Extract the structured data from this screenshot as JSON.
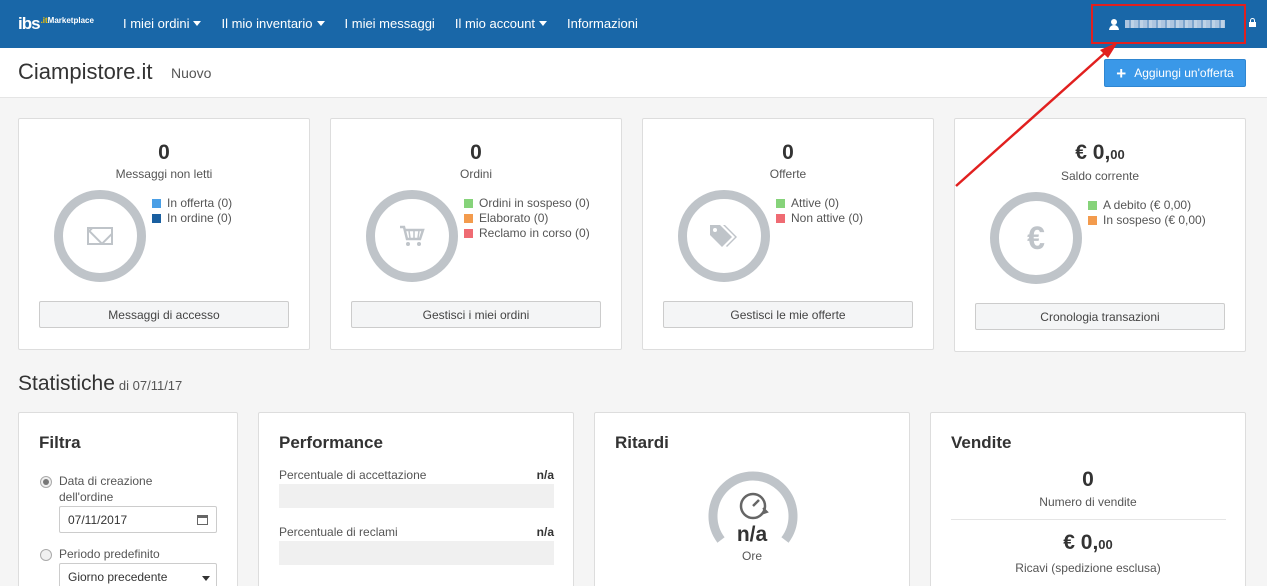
{
  "nav": {
    "logo_main": "ibs",
    "logo_it": ".it",
    "logo_sub": "Marketplace",
    "items": [
      {
        "label": "I miei ordini",
        "dropdown": true
      },
      {
        "label": "Il mio inventario",
        "dropdown": true
      },
      {
        "label": "I miei messaggi",
        "dropdown": false
      },
      {
        "label": "Il mio account",
        "dropdown": true
      },
      {
        "label": "Informazioni",
        "dropdown": false
      }
    ],
    "user_icon": "user-icon",
    "lock_icon": "lock-icon"
  },
  "header": {
    "store_name": "Ciampistore.it",
    "status": "Nuovo",
    "add_offer_label": "Aggiungi un'offerta"
  },
  "cards": {
    "messages": {
      "value": "0",
      "label": "Messaggi non letti",
      "icon": "envelope-icon",
      "legend": [
        {
          "label": "In offerta (0)",
          "color": "#4a9fe6"
        },
        {
          "label": "In ordine (0)",
          "color": "#1a5fa0"
        }
      ],
      "button": "Messaggi di accesso"
    },
    "orders": {
      "value": "0",
      "label": "Ordini",
      "icon": "cart-icon",
      "legend": [
        {
          "label": "Ordini in sospeso (0)",
          "color": "#86d37a"
        },
        {
          "label": "Elaborato (0)",
          "color": "#f39b4d"
        },
        {
          "label": "Reclamo in corso (0)",
          "color": "#ef6b73"
        }
      ],
      "button": "Gestisci i miei ordini"
    },
    "offers": {
      "value": "0",
      "label": "Offerte",
      "icon": "tags-icon",
      "legend": [
        {
          "label": "Attive (0)",
          "color": "#86d37a"
        },
        {
          "label": "Non attive (0)",
          "color": "#ef6b73"
        }
      ],
      "button": "Gestisci le mie offerte"
    },
    "balance": {
      "value_main": "€ 0,",
      "value_decimals": "00",
      "label": "Saldo corrente",
      "icon": "euro-icon",
      "icon_glyph": "€",
      "legend": [
        {
          "label": "A debito (€ 0,00)",
          "color": "#86d37a"
        },
        {
          "label": "In sospeso (€ 0,00)",
          "color": "#f39b4d"
        }
      ],
      "button": "Cronologia transazioni"
    }
  },
  "stats": {
    "title": "Statistiche",
    "date": "di 07/11/17",
    "filter": {
      "title": "Filtra",
      "option1": "Data di creazione dell'ordine",
      "date_value": "07/11/2017",
      "option2": "Periodo predefinito",
      "period_value": "Giorno precedente"
    },
    "performance": {
      "title": "Performance",
      "rows": [
        {
          "label": "Percentuale di accettazione",
          "value": "n/a"
        },
        {
          "label": "Percentuale di reclami",
          "value": "n/a"
        }
      ]
    },
    "delays": {
      "title": "Ritardi",
      "value": "n/a",
      "unit": "Ore"
    },
    "sales": {
      "title": "Vendite",
      "count": "0",
      "count_label": "Numero di vendite",
      "revenue_main": "€ 0,",
      "revenue_decimals": "00",
      "revenue_label": "Ricavi (spedizione esclusa)"
    }
  }
}
